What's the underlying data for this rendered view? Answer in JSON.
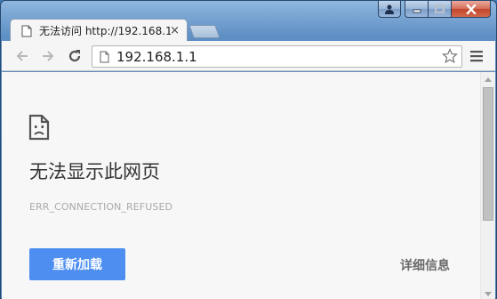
{
  "window": {
    "caption_buttons": [
      "user-icon",
      "minimize-icon",
      "maximize-icon",
      "close-icon"
    ],
    "frame_color": "#4b80bb"
  },
  "tab": {
    "title": "无法访问 http://192.168.1.1",
    "close_glyph": "×",
    "icon": "page-icon"
  },
  "toolbar": {
    "back_icon": "back-arrow-icon",
    "forward_icon": "forward-arrow-icon",
    "reload_icon": "reload-icon",
    "url": "192.168.1.1",
    "bookmark_icon": "star-icon",
    "menu_icon": "menu-icon"
  },
  "error_page": {
    "icon": "sad-page-icon",
    "title": "无法显示此网页",
    "error_code": "ERR_CONNECTION_REFUSED",
    "reload_label": "重新加载",
    "details_label": "详细信息",
    "button_color": "#4d8ef0"
  }
}
